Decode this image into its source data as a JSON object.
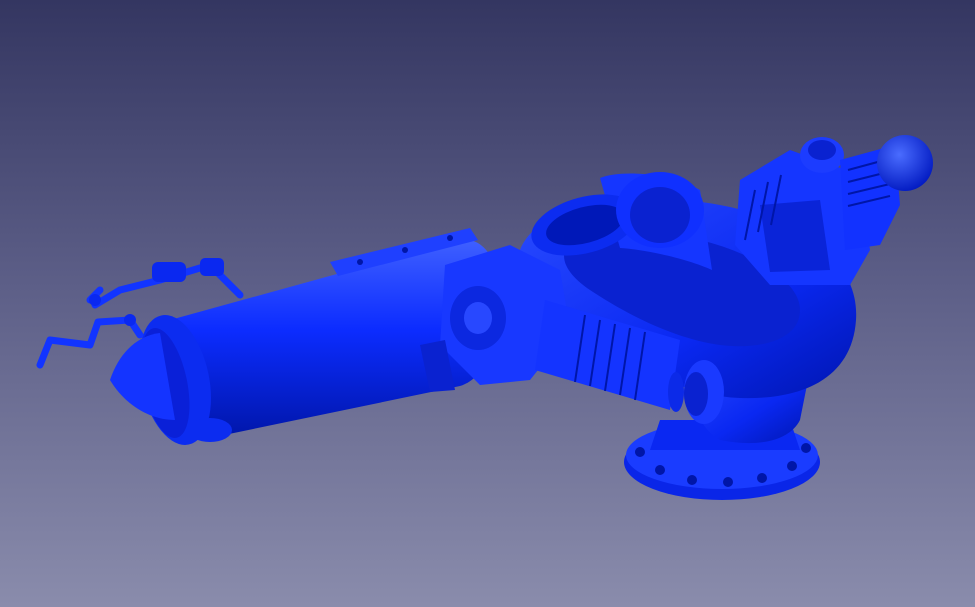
{
  "viewport": {
    "background_top": "#343661",
    "background_bottom": "#8a8cac"
  },
  "model": {
    "description_icon": "fire-monitor-cannon-3d-model",
    "shade_color": "#0b2bff",
    "highlight_color": "#3a5cff",
    "shadow_color": "#0018b8"
  }
}
